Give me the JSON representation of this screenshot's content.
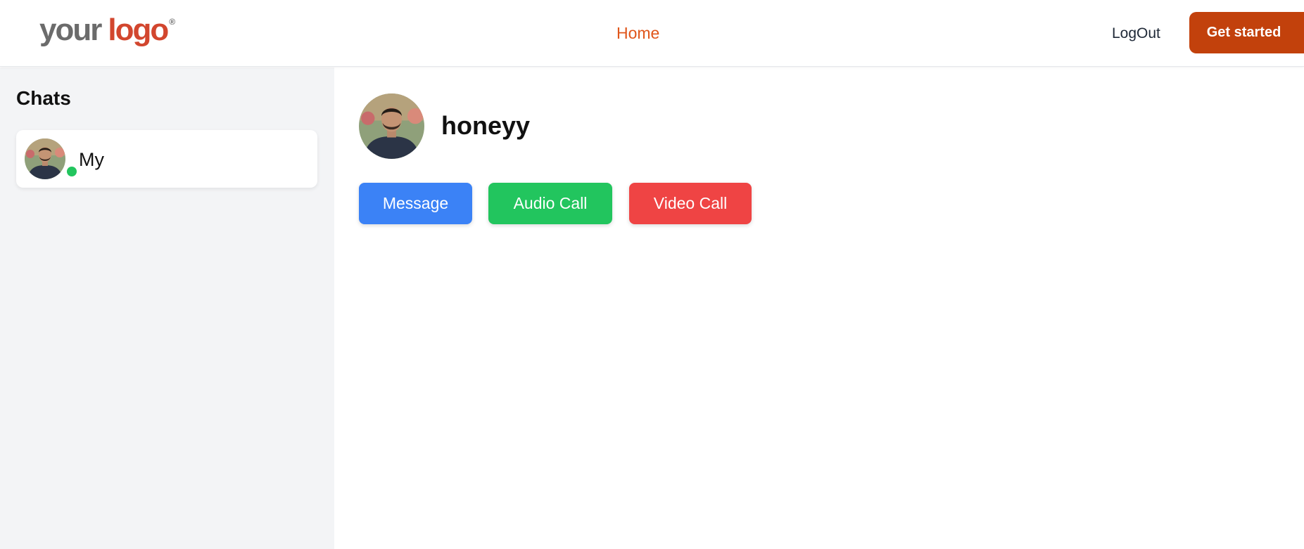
{
  "header": {
    "logo": {
      "word1": "your",
      "word2": "logo",
      "mark": "®"
    },
    "nav_home": "Home",
    "logout": "LogOut",
    "get_started": "Get started"
  },
  "sidebar": {
    "title": "Chats",
    "chats": [
      {
        "name": "My",
        "status": "online"
      }
    ]
  },
  "profile": {
    "name": "honeyy",
    "actions": {
      "message": "Message",
      "audio_call": "Audio Call",
      "video_call": "Video Call"
    }
  },
  "colors": {
    "accent": "#e0561b",
    "cta": "#c2410c",
    "message": "#3b82f6",
    "audio": "#22c55e",
    "video": "#ef4444",
    "online": "#22c55e",
    "sidebar_bg": "#f3f4f6"
  }
}
